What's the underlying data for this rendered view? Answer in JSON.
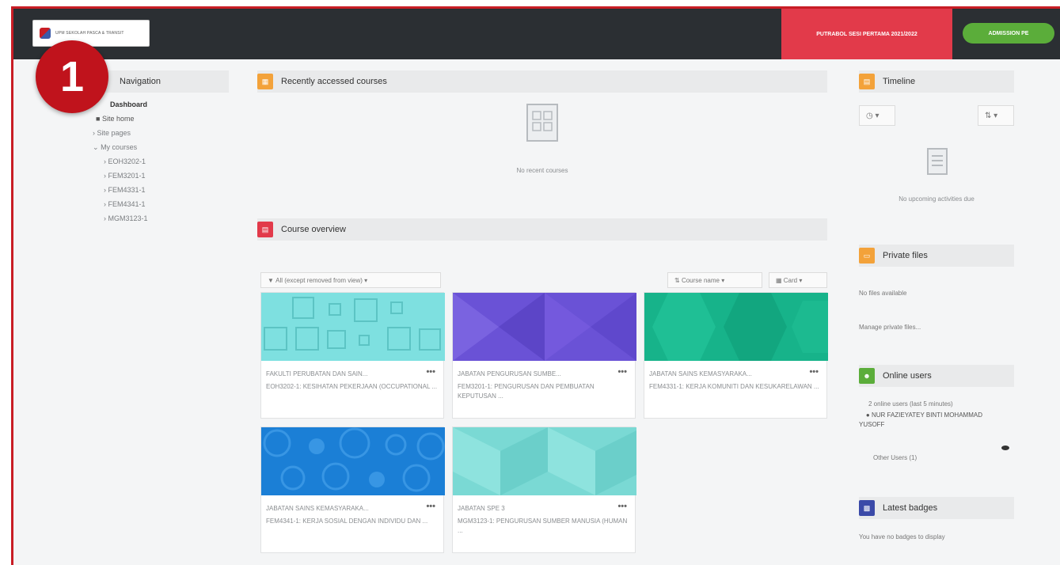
{
  "topbar": {
    "logo_text": "UPM SEKOLAH PASCA & TRANSIT",
    "session_label": "PUTRABOL SESI PERTAMA 2021/2022",
    "admission_label": "ADMISSION PE",
    "colors": {
      "bar": "#2b2f33",
      "session": "#e23a4a",
      "admission": "#5bad3a"
    }
  },
  "marker": {
    "number": "1"
  },
  "navigation": {
    "title": "Navigation",
    "dashboard": "Dashboard",
    "site_home": "Site home",
    "site_pages": "Site pages",
    "my_courses": "My courses",
    "courses": [
      "EOH3202-1",
      "FEM3201-1",
      "FEM4331-1",
      "FEM4341-1",
      "MGM3123-1"
    ]
  },
  "recent": {
    "title": "Recently accessed courses",
    "empty": "No recent courses"
  },
  "overview": {
    "title": "Course overview",
    "filter": "All (except removed from view)",
    "sort": "Course name",
    "view": "Card",
    "cards": [
      {
        "category": "FAKULTI PERUBATAN DAN SAIN...",
        "name": "EOH3202-1: KESIHATAN PEKERJAAN (OCCUPATIONAL ...",
        "more": "•••",
        "color": "#7ee0e0"
      },
      {
        "category": "JABATAN PENGURUSAN SUMBE...",
        "name": "FEM3201-1: PENGURUSAN DAN PEMBUATAN KEPUTUSAN ...",
        "more": "•••",
        "color": "#6a52d6"
      },
      {
        "category": "JABATAN SAINS KEMASYARAKA...",
        "name": "FEM4331-1: KERJA KOMUNITI DAN KESUKARELAWAN ...",
        "more": "•••",
        "color": "#17b38a"
      },
      {
        "category": "JABATAN SAINS KEMASYARAKA...",
        "name": "FEM4341-1: KERJA SOSIAL DENGAN INDIVIDU DAN ...",
        "more": "•••",
        "color": "#1b7fd6"
      },
      {
        "category": "JABATAN SPE 3",
        "name": "MGM3123-1: PENGURUSAN SUMBER MANUSIA (HUMAN ...",
        "more": "•••",
        "color": "#7ad9d4"
      }
    ]
  },
  "timeline": {
    "title": "Timeline",
    "empty": "No upcoming activities due"
  },
  "private_files": {
    "title": "Private files",
    "empty": "No files available",
    "manage": "Manage private files..."
  },
  "online_users": {
    "title": "Online users",
    "summary": "2 online users (last 5 minutes)",
    "user": "NUR FAZIEYATEY BINTI MOHAMMAD YUSOFF",
    "other": "Other Users (1)"
  },
  "latest_badges": {
    "title": "Latest badges",
    "empty": "You have no badges to display"
  }
}
